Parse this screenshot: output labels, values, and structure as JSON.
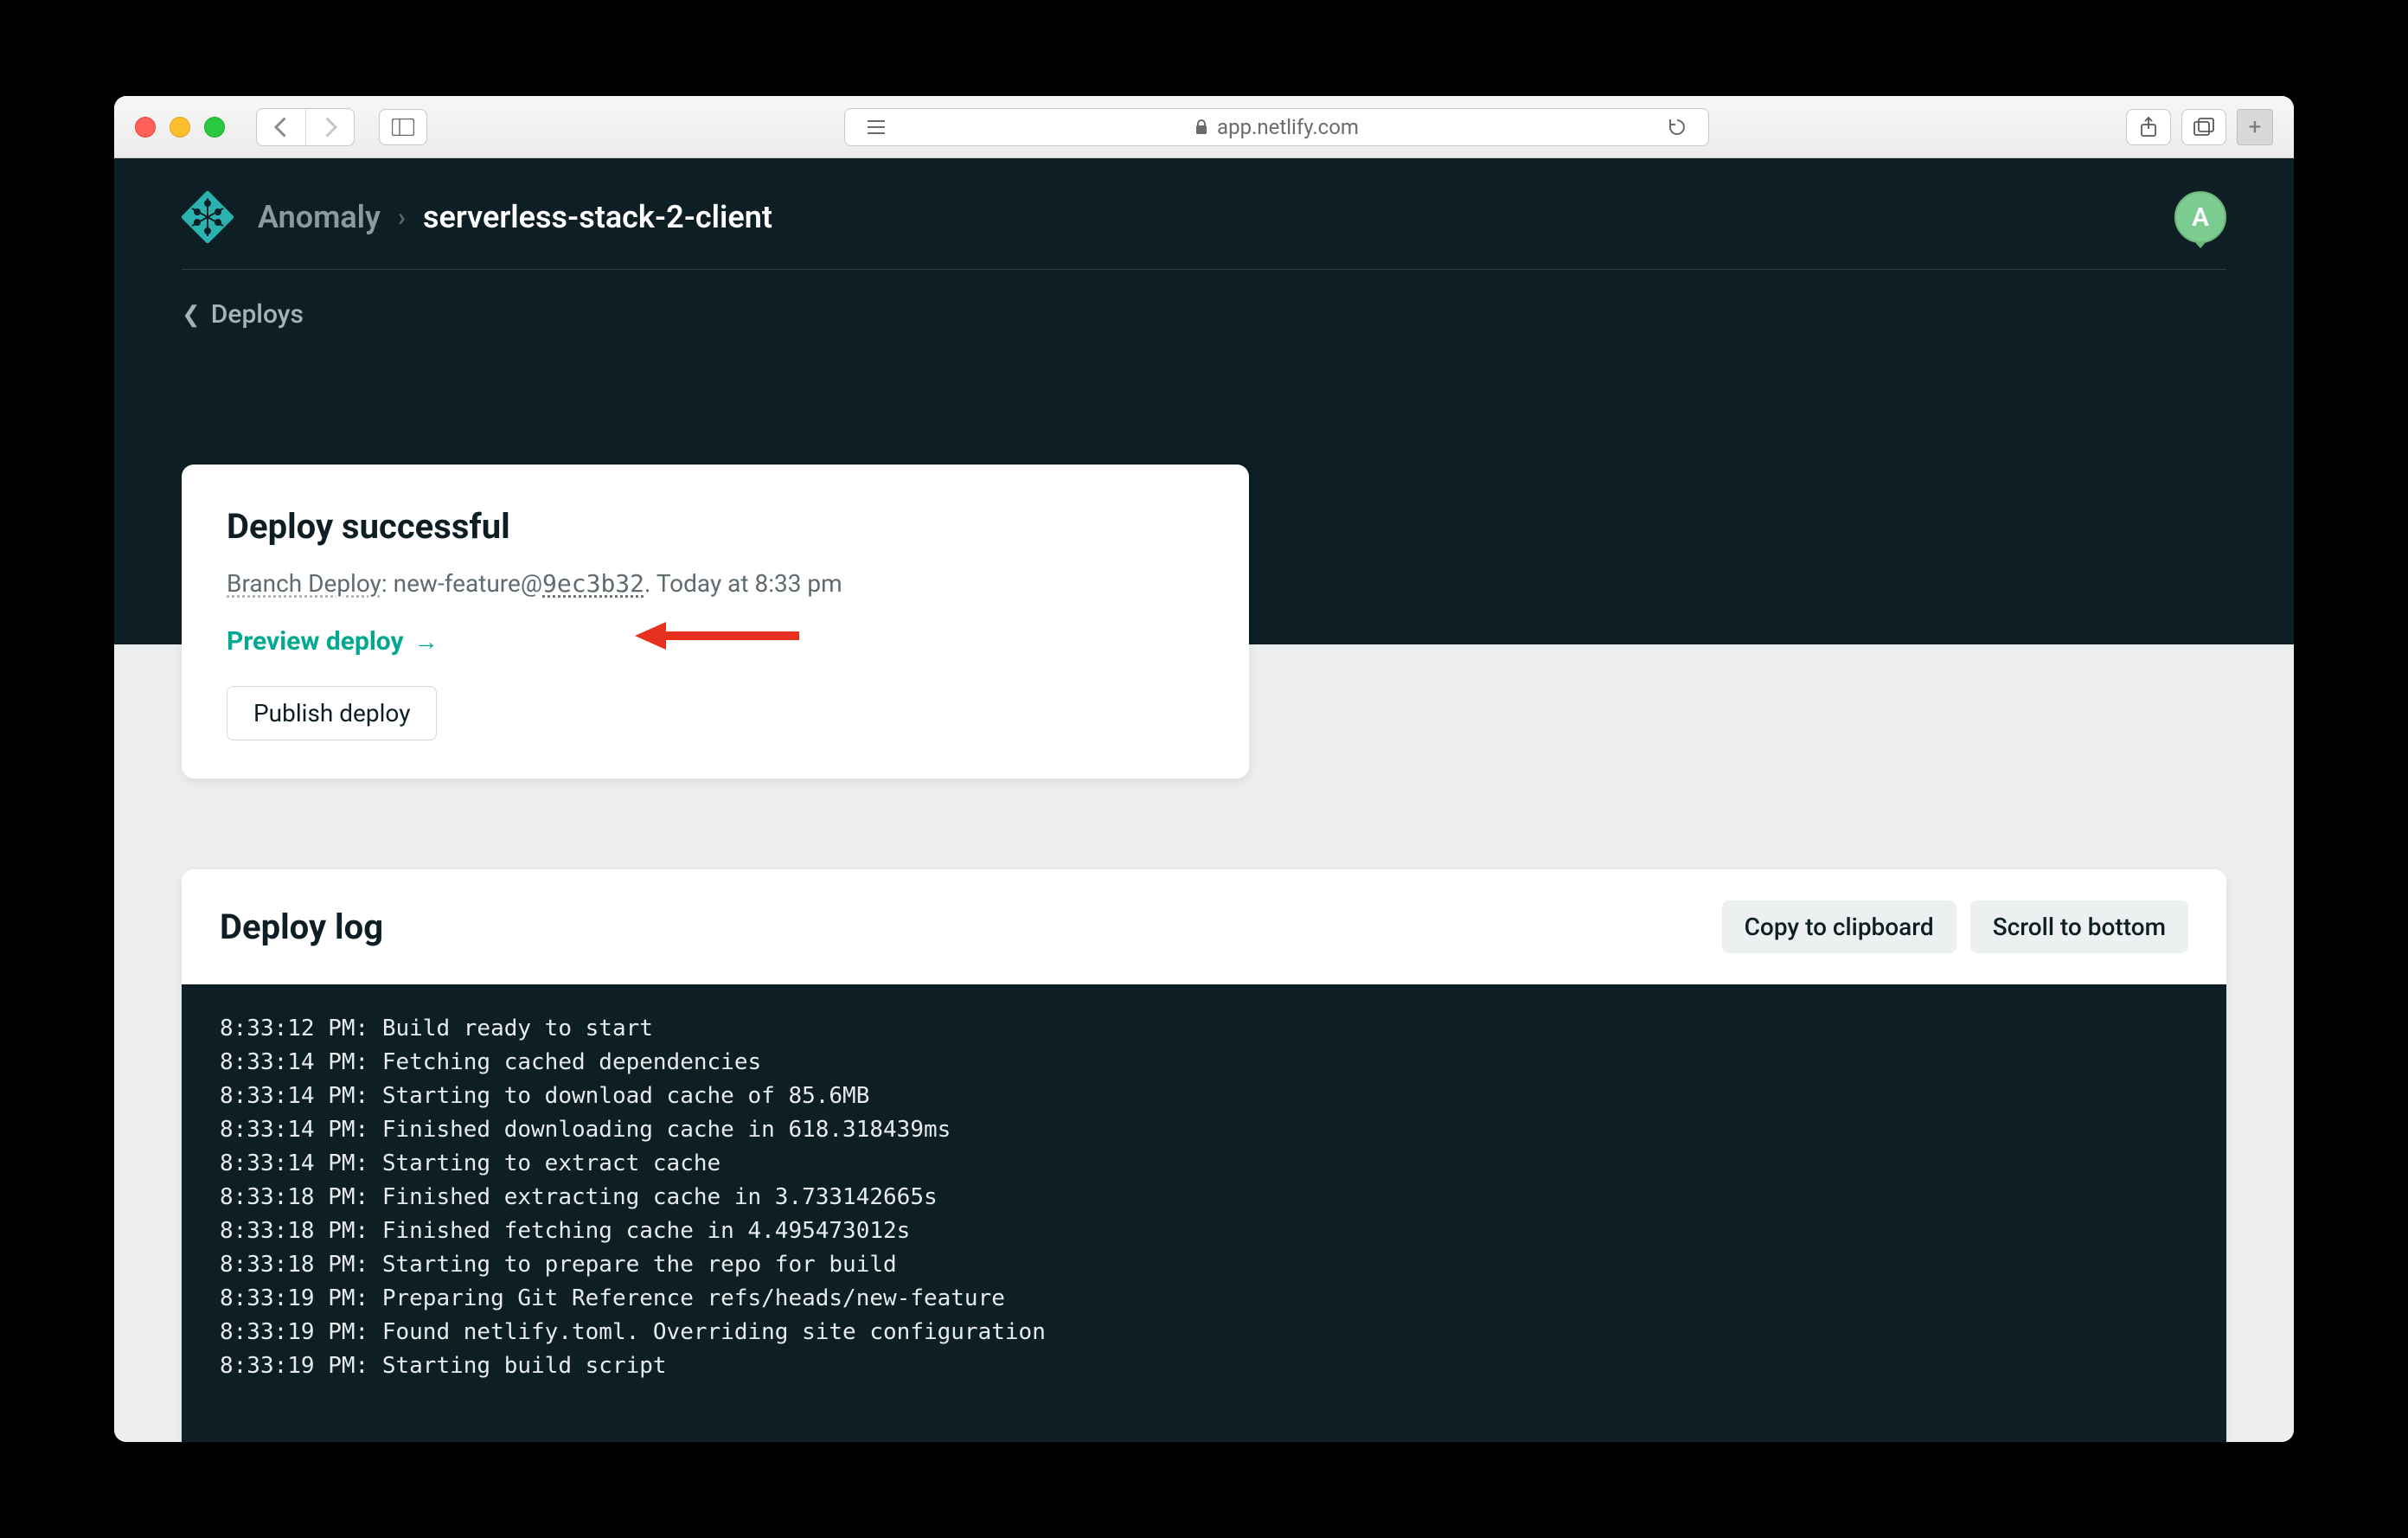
{
  "browser": {
    "url_host": "app.netlify.com"
  },
  "header": {
    "team": "Anomaly",
    "project": "serverless-stack-2-client",
    "avatar_letter": "A"
  },
  "back": {
    "label": "Deploys"
  },
  "deploy": {
    "title": "Deploy successful",
    "branch_label": "Branch Deploy",
    "branch_name": "new-feature",
    "commit": "9ec3b32",
    "timestamp": "Today at 8:33 pm",
    "preview_label": "Preview deploy",
    "publish_label": "Publish deploy"
  },
  "log": {
    "title": "Deploy log",
    "copy_label": "Copy to clipboard",
    "scroll_label": "Scroll to bottom",
    "lines": [
      "8:33:12 PM: Build ready to start",
      "8:33:14 PM: Fetching cached dependencies",
      "8:33:14 PM: Starting to download cache of 85.6MB",
      "8:33:14 PM: Finished downloading cache in 618.318439ms",
      "8:33:14 PM: Starting to extract cache",
      "8:33:18 PM: Finished extracting cache in 3.733142665s",
      "8:33:18 PM: Finished fetching cache in 4.495473012s",
      "8:33:18 PM: Starting to prepare the repo for build",
      "8:33:19 PM: Preparing Git Reference refs/heads/new-feature",
      "8:33:19 PM: Found netlify.toml. Overriding site configuration",
      "8:33:19 PM: Starting build script"
    ]
  }
}
